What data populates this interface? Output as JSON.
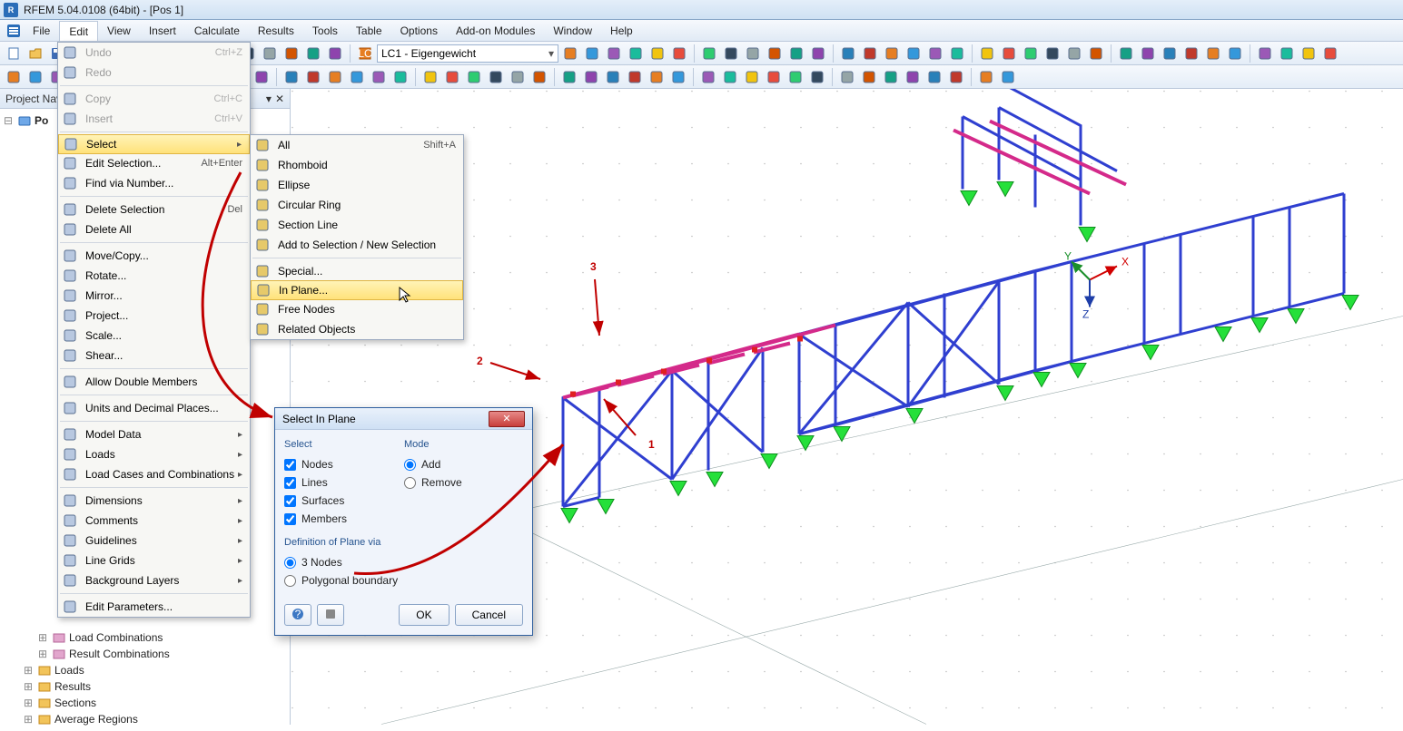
{
  "title": "RFEM 5.04.0108 (64bit) - [Pos 1]",
  "menubar": [
    "File",
    "Edit",
    "View",
    "Insert",
    "Calculate",
    "Results",
    "Tools",
    "Table",
    "Options",
    "Add-on Modules",
    "Window",
    "Help"
  ],
  "toolbar_combo": "LC1 - Eigengewicht",
  "left_header": "Project Nav",
  "tree": {
    "root": "Po",
    "nodes_end": [
      "Load Combinations",
      "Result Combinations",
      "Loads",
      "Results",
      "Sections",
      "Average Regions"
    ]
  },
  "edit_menu": {
    "items": [
      {
        "label": "Undo",
        "shortcut": "Ctrl+Z",
        "disabled": true,
        "icon": "undo"
      },
      {
        "label": "Redo",
        "shortcut": "",
        "disabled": true,
        "icon": "redo"
      },
      {
        "sep": true
      },
      {
        "label": "Copy",
        "shortcut": "Ctrl+C",
        "disabled": true,
        "icon": "copy"
      },
      {
        "label": "Insert",
        "shortcut": "Ctrl+V",
        "disabled": true,
        "icon": "paste"
      },
      {
        "sep": true
      },
      {
        "label": "Select",
        "submenu": true,
        "highlight": true,
        "icon": "select"
      },
      {
        "label": "Edit Selection...",
        "shortcut": "Alt+Enter",
        "icon": "edit-selection"
      },
      {
        "label": "Find via Number...",
        "icon": "find"
      },
      {
        "sep": true
      },
      {
        "label": "Delete Selection",
        "shortcut": "Del",
        "icon": "delete"
      },
      {
        "label": "Delete All",
        "icon": "delete-all"
      },
      {
        "sep": true
      },
      {
        "label": "Move/Copy...",
        "icon": "move"
      },
      {
        "label": "Rotate...",
        "icon": "rotate"
      },
      {
        "label": "Mirror...",
        "icon": "mirror"
      },
      {
        "label": "Project...",
        "icon": "project"
      },
      {
        "label": "Scale...",
        "icon": "scale"
      },
      {
        "label": "Shear...",
        "icon": "shear"
      },
      {
        "sep": true
      },
      {
        "label": "Allow Double Members",
        "icon": "double"
      },
      {
        "sep": true
      },
      {
        "label": "Units and Decimal Places...",
        "icon": "units"
      },
      {
        "sep": true
      },
      {
        "label": "Model Data",
        "submenu": true
      },
      {
        "label": "Loads",
        "submenu": true
      },
      {
        "label": "Load Cases and Combinations",
        "submenu": true
      },
      {
        "sep": true
      },
      {
        "label": "Dimensions",
        "submenu": true
      },
      {
        "label": "Comments",
        "submenu": true
      },
      {
        "label": "Guidelines",
        "submenu": true
      },
      {
        "label": "Line Grids",
        "submenu": true
      },
      {
        "label": "Background Layers",
        "submenu": true
      },
      {
        "sep": true
      },
      {
        "label": "Edit Parameters...",
        "icon": "params"
      }
    ]
  },
  "select_submenu": {
    "items": [
      {
        "label": "All",
        "shortcut": "Shift+A",
        "icon": "all"
      },
      {
        "label": "Rhomboid",
        "icon": "rhomboid"
      },
      {
        "label": "Ellipse",
        "icon": "ellipse"
      },
      {
        "label": "Circular Ring",
        "icon": "ring"
      },
      {
        "label": "Section Line",
        "icon": "section"
      },
      {
        "label": "Add to Selection / New Selection",
        "icon": "addnew"
      },
      {
        "sep": true
      },
      {
        "label": "Special...",
        "icon": "special"
      },
      {
        "label": "In Plane...",
        "highlight": true,
        "icon": "plane"
      },
      {
        "label": "Free Nodes",
        "icon": "freenodes"
      },
      {
        "label": "Related Objects",
        "icon": "related"
      }
    ]
  },
  "dialog": {
    "title": "Select In Plane",
    "select_group": "Select",
    "mode_group": "Mode",
    "checks": {
      "nodes": "Nodes",
      "lines": "Lines",
      "surfaces": "Surfaces",
      "members": "Members"
    },
    "modes": {
      "add": "Add",
      "remove": "Remove"
    },
    "def_group": "Definition of Plane via",
    "defs": {
      "nodes3": "3 Nodes",
      "poly": "Polygonal boundary"
    },
    "ok": "OK",
    "cancel": "Cancel"
  },
  "annotations": {
    "p1": "1",
    "p2": "2",
    "p3": "3"
  },
  "axis": {
    "x": "X",
    "y": "Y",
    "z": "Z"
  }
}
